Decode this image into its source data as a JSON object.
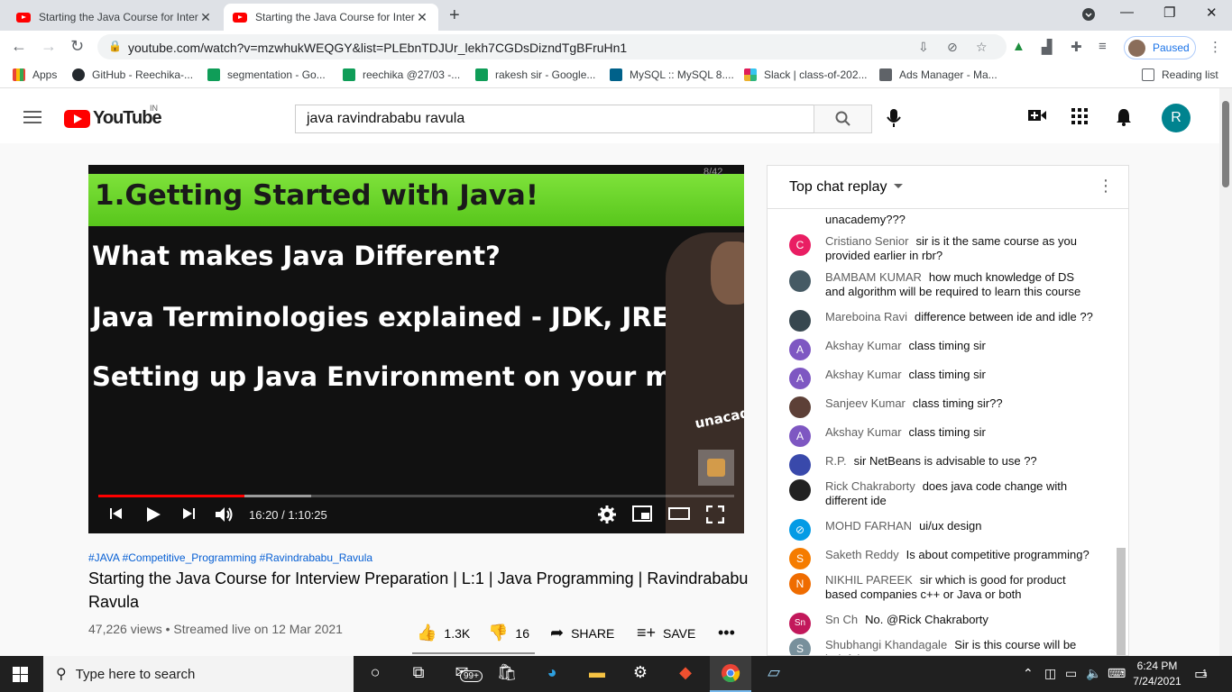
{
  "browser": {
    "tabs": [
      {
        "title": "Starting the Java Course for Inter",
        "active": false
      },
      {
        "title": "Starting the Java Course for Inter",
        "active": true
      }
    ],
    "url": "youtube.com/watch?v=mzwhukWEQGY&list=PLEbnTDJUr_lekh7CGDsDizndTgBFruHn1",
    "profile_status": "Paused",
    "bookmarks": [
      {
        "label": "Apps"
      },
      {
        "label": "GitHub - Reechika-..."
      },
      {
        "label": "segmentation - Go..."
      },
      {
        "label": "reechika @27/03 -..."
      },
      {
        "label": "rakesh sir - Google..."
      },
      {
        "label": "MySQL :: MySQL 8...."
      },
      {
        "label": "Slack | class-of-202..."
      },
      {
        "label": "Ads Manager - Ma..."
      }
    ],
    "reading_list": "Reading list"
  },
  "youtube": {
    "logo_text": "YouTube",
    "country": "IN",
    "search_query": "java ravindrababu ravula",
    "avatar_letter": "R"
  },
  "video": {
    "slide_title": "1.Getting Started with Java!",
    "slide_lines": [
      "What makes Java Different?",
      "Java Terminologies explained - JDK, JRE, JVM",
      "Setting up Java Environment on your machine"
    ],
    "slide_page": "8/42",
    "watermark_text": "unacad",
    "time_display": "16:20 / 1:10:25",
    "played_fraction": 0.23,
    "buffered_fraction": 0.335
  },
  "details": {
    "hashtags": "#JAVA #Competitive_Programming #Ravindrababu_Ravula",
    "title": "Starting the Java Course for Interview Preparation | L:1 | Java Programming | Ravindrababu Ravula",
    "views": "47,226 views • Streamed live on 12 Mar 2021",
    "likes": "1.3K",
    "dislikes": "16",
    "share": "SHARE",
    "save": "SAVE"
  },
  "chat": {
    "header": "Top chat replay",
    "first_fragment": "unacademy???",
    "messages": [
      {
        "author": "Cristiano Senior",
        "text": "sir is it the same course as you provided earlier in rbr?",
        "initial": "C",
        "color": "#e91e63"
      },
      {
        "author": "BAMBAM KUMAR",
        "text": "how much knowledge of DS and algorithm will be required to learn this course",
        "initial": "",
        "color": "#455a64"
      },
      {
        "author": "Mareboina Ravi",
        "text": "difference between ide and idle ??",
        "initial": "",
        "color": "#37474f"
      },
      {
        "author": "Akshay Kumar",
        "text": "class timing sir",
        "initial": "A",
        "color": "#7e57c2"
      },
      {
        "author": "Akshay Kumar",
        "text": "class timing sir",
        "initial": "A",
        "color": "#7e57c2"
      },
      {
        "author": "Sanjeev Kumar",
        "text": "class timing sir??",
        "initial": "",
        "color": "#5d4037"
      },
      {
        "author": "Akshay Kumar",
        "text": "class timing sir",
        "initial": "A",
        "color": "#7e57c2"
      },
      {
        "author": "R.P.",
        "text": "sir NetBeans is advisable to use ??",
        "initial": "",
        "color": "#3949ab"
      },
      {
        "author": "Rick Chakraborty",
        "text": "does java code change with different ide",
        "initial": "",
        "color": "#212121"
      },
      {
        "author": "MOHD FARHAN",
        "text": "ui/ux design",
        "initial": "⊘",
        "color": "#039be5"
      },
      {
        "author": "Saketh Reddy",
        "text": "Is about competitive programming?",
        "initial": "S",
        "color": "#f57c00"
      },
      {
        "author": "NIKHIL PAREEK",
        "text": "sir which is good for product based companies c++ or Java or both",
        "initial": "N",
        "color": "#ef6c00"
      },
      {
        "author": "Sn Ch",
        "text": "No. @Rick Chakraborty",
        "initial": "Sn",
        "color": "#c2185b"
      },
      {
        "author": "Shubhangi Khandagale",
        "text": "Sir is this course will be helpful",
        "initial": "S",
        "color": "#78909c"
      }
    ]
  },
  "taskbar": {
    "search_placeholder": "Type here to search",
    "mail_badge": "99+",
    "time": "6:24 PM",
    "date": "7/24/2021",
    "notification_count": "1"
  }
}
